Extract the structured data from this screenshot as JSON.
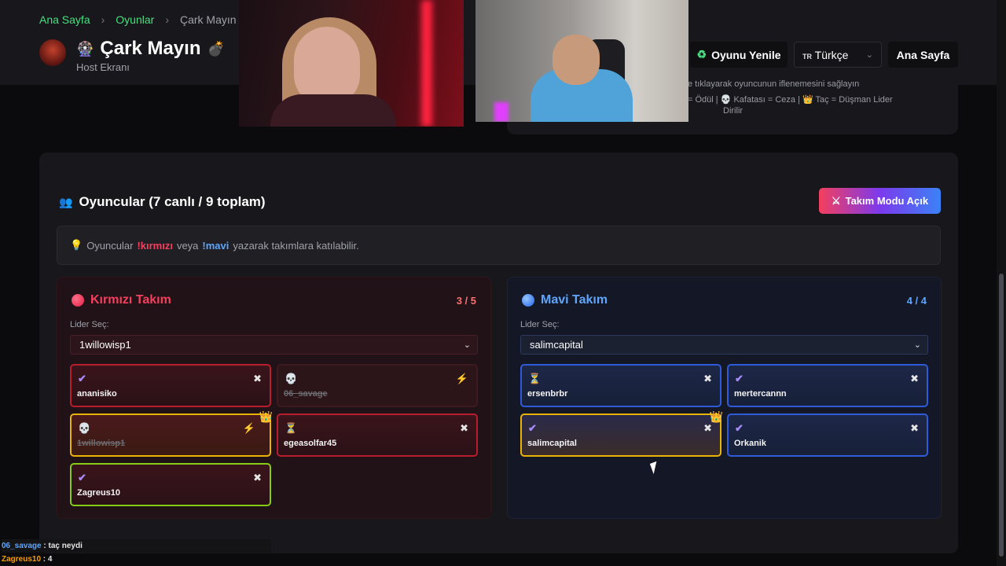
{
  "breadcrumb": {
    "home": "Ana Sayfa",
    "games": "Oyunlar",
    "current": "Çark Mayın"
  },
  "header": {
    "title": "Çark Mayın",
    "subtitle": "Host Ekranı",
    "wheel_icon": "🎡",
    "bomb_icon": "💣",
    "refresh_icon": "♻",
    "refresh_label": "Oyunu Yenile",
    "lang_flag": "TR",
    "lang_label": "Türkçe",
    "home_label": "Ana Sayfa"
  },
  "info": {
    "line1": "e tıklayarak oyuncunun iflenemesini sağlayın",
    "line2": "= Ödül | 💀 Kafatası = Ceza | 👑 Taç = Düşman Lider",
    "line3": "Dirilir"
  },
  "players_panel": {
    "icon": "👥",
    "title": "Oyuncular (7 canlı / 9 toplam)",
    "team_mode_icon": "⚔",
    "team_mode_label": "Takım Modu Açık",
    "tip_icon": "💡",
    "tip_prefix": "Oyuncular",
    "tip_red": "!kırmızı",
    "tip_mid": "veya",
    "tip_blue": "!mavi",
    "tip_suffix": "yazarak takımlara katılabilir."
  },
  "red_team": {
    "name": "Kırmızı Takım",
    "count": "3 / 5",
    "leader_label": "Lider Seç:",
    "leader_value": "1willowisp1",
    "players": [
      {
        "status": "✔",
        "action": "✖",
        "name": "ananisiko"
      },
      {
        "status": "💀",
        "action": "⚡",
        "name": "06_savage"
      },
      {
        "status": "💀",
        "action": "⚡",
        "name": "1willowisp1",
        "crown": "👑"
      },
      {
        "status": "⏳",
        "action": "✖",
        "name": "egeasolfar45"
      },
      {
        "status": "✔",
        "action": "✖",
        "name": "Zagreus10"
      }
    ]
  },
  "blue_team": {
    "name": "Mavi Takım",
    "count": "4 / 4",
    "leader_label": "Lider Seç:",
    "leader_value": "salimcapital",
    "players": [
      {
        "status": "⏳",
        "action": "✖",
        "name": "ersenbrbr"
      },
      {
        "status": "✔",
        "action": "✖",
        "name": "mertercannn"
      },
      {
        "status": "✔",
        "action": "✖",
        "name": "salimcapital",
        "crown": "👑"
      },
      {
        "status": "✔",
        "action": "✖",
        "name": "Orkanik"
      }
    ]
  },
  "chat": [
    {
      "user": "06_savage",
      "message": "taç neydi"
    },
    {
      "user": "Zagreus10",
      "message": "4"
    }
  ],
  "colors": {
    "accent_green": "#4ade80",
    "red": "#f43f5e",
    "blue": "#60a5fa",
    "leader_gold": "#eab308"
  }
}
